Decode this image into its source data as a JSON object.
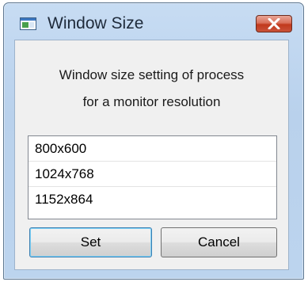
{
  "window": {
    "title": "Window Size",
    "icon": "app-window-icon",
    "close_icon": "close-icon"
  },
  "description": {
    "line1": "Window size setting of process",
    "line2": "for a monitor resolution"
  },
  "resolutions": [
    "800x600",
    "1024x768",
    "1152x864"
  ],
  "buttons": {
    "set_label": "Set",
    "cancel_label": "Cancel"
  },
  "colors": {
    "frame": "#bcd4ee",
    "close_button": "#c7452a",
    "default_button_glow": "#7dd1f7"
  }
}
